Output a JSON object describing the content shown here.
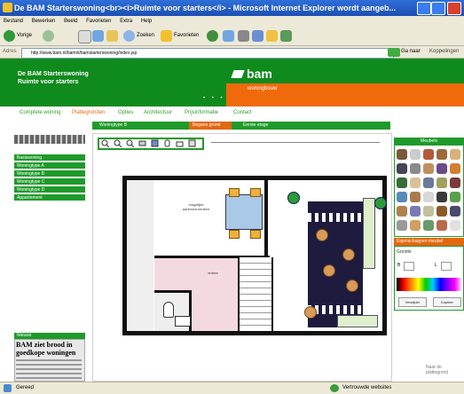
{
  "window": {
    "title": "De BAM Starterswoning<br><i>Ruimte voor starters</i> - Microsoft Internet Explorer wordt aangeb...",
    "menu": [
      "Bestand",
      "Bewerken",
      "Beeld",
      "Favorieten",
      "Extra",
      "Help"
    ]
  },
  "toolbar": {
    "back_label": "Vorige",
    "search_label": "Zoeken",
    "favorites_label": "Favorieten"
  },
  "address": {
    "label": "Adres",
    "url": "http://www.bam.nl/bamnl/bamstarterswoning/index.jsp",
    "go_label": "Ga naar",
    "links_label": "Koppelingen"
  },
  "site": {
    "brand_line1": "De BAM Starterswoning",
    "brand_line2": "Ruimte voor starters",
    "logo": "bam",
    "tagline": "woningbouw",
    "nav": [
      "Complete woning",
      "Plattegronden",
      "Opties",
      "Architectuur",
      "Prijsinformatie",
      "Contact"
    ],
    "active_nav_index": 1
  },
  "left_nav": {
    "items": [
      "Basiswoning",
      "Woningtype A",
      "Woningtype B",
      "Woningtype C",
      "Woningtype D",
      "Appartement"
    ]
  },
  "news": {
    "header": "Nieuws",
    "headline": "BAM ziet brood in goedkope woningen"
  },
  "tabs": {
    "type_label": "Woningtype B",
    "ground_label": "Begane grond",
    "first_label": "Eerste etage"
  },
  "plan": {
    "hall_label": "mogelijke aanbouw keuken",
    "pink_label": "entree"
  },
  "panels": {
    "meubels_title": "Meubels",
    "props_title": "Eigenschappen meubel",
    "props_label": "Grootte",
    "field_b": "B",
    "field_l": "L",
    "delete_button": "Verwijder",
    "copy_button": "Kopieer"
  },
  "footnote": "Naar de plattegrond",
  "status": {
    "left": "Gereed",
    "zone": "Vertrouwde websites"
  },
  "colors": {
    "brand_green": "#1f9a2a",
    "brand_orange": "#e2680f",
    "xp_blue": "#2f6fd8"
  }
}
